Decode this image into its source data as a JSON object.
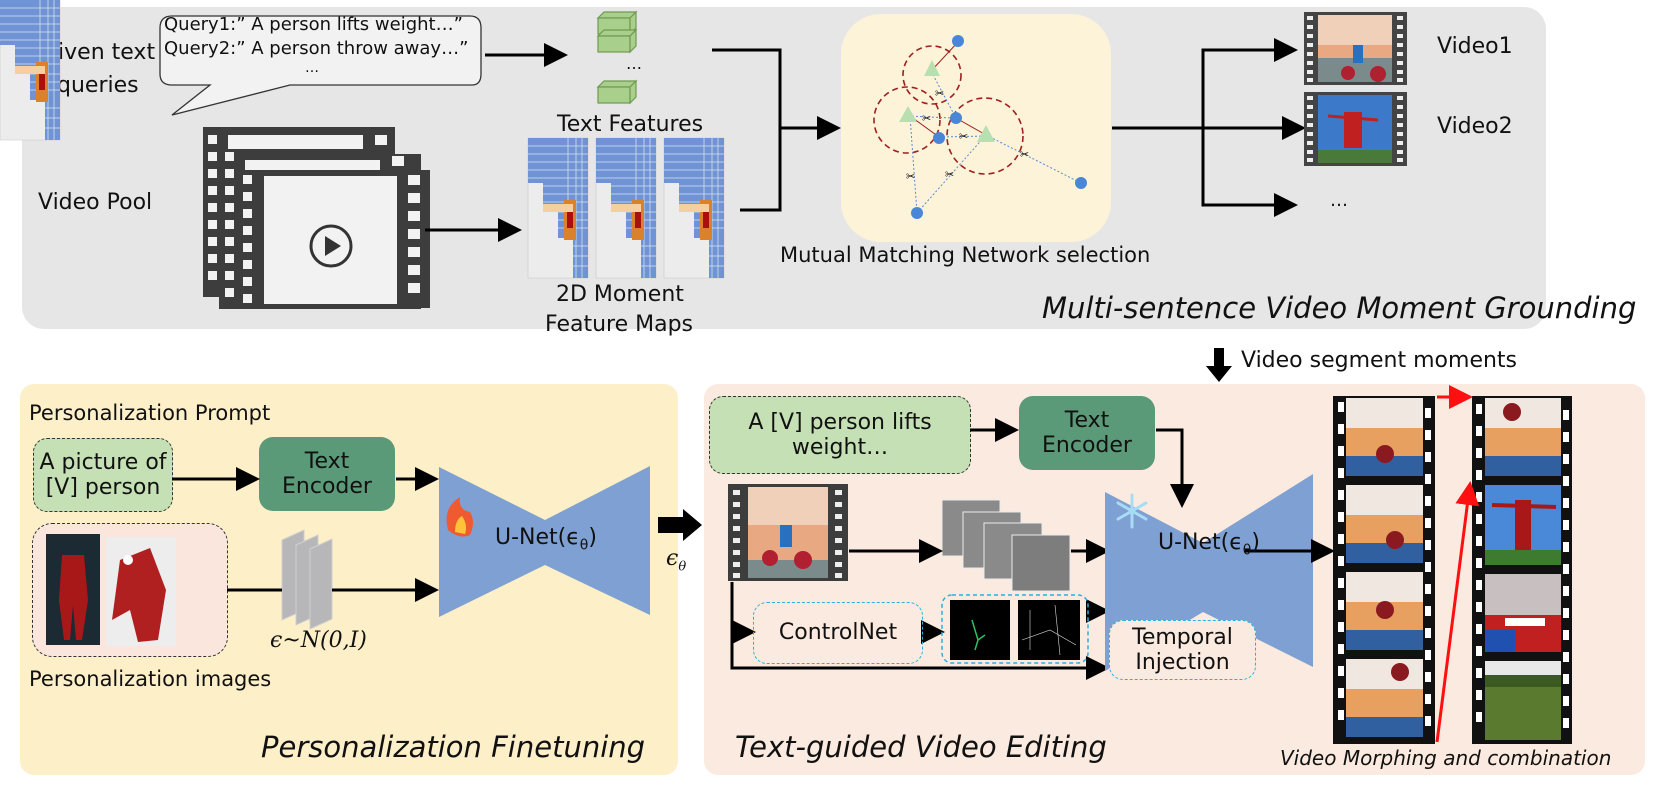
{
  "top_panel": {
    "title": "Multi-sentence Video Moment Grounding",
    "given_text_label_1": "Given text",
    "given_text_label_2": "queries",
    "queries": [
      "Query1:”  A person lifts weight…”",
      "Query2:”  A person throw away…”",
      "…"
    ],
    "video_pool_label": "Video Pool",
    "text_features_label": "Text Features",
    "text_features_ellipsis": "…",
    "feature_maps_label_1": "2D Moment",
    "feature_maps_label_2": "Feature Maps",
    "matching_label": "Mutual Matching Network selection",
    "outputs": [
      "Video1",
      "Video2",
      "…"
    ]
  },
  "transition_label": "Video segment moments",
  "personalization_panel": {
    "title": "Personalization Finetuning",
    "prompt_heading": "Personalization Prompt",
    "prompt_box_1": "A picture of",
    "prompt_box_2": "[V] person",
    "text_encoder_1": "Text",
    "text_encoder_2": "Encoder",
    "unet_label": "U-Net(ϵ",
    "unet_sub": "θ",
    "noise_label": "ϵ~N(0,I)",
    "images_label": "Personalization images"
  },
  "eps_label": "ϵ",
  "eps_sub": "θ",
  "editing_panel": {
    "title": "Text-guided Video Editing",
    "prompt_box_1": "A [V] person lifts",
    "prompt_box_2": "weight…",
    "text_encoder_1": "Text",
    "text_encoder_2": "Encoder",
    "unet_label": "U-Net(ϵ",
    "unet_sub": "θ",
    "controlnet_label": "ControlNet",
    "temporal_1": "Temporal",
    "temporal_2": "Injection",
    "morphing_label": "Video Morphing and combination"
  },
  "colors": {
    "top_bg": "#e6e6e6",
    "personalization_bg": "#fdefc8",
    "editing_bg": "#fbeadf",
    "matching_bg": "#fdf3d8",
    "prompt_green": "#c5e0b4",
    "encoder_green": "#5b9a78",
    "unet_blue": "#7fa0d2",
    "dashed_cyan": "#2bb0e0",
    "red_arrow": "#ff1010",
    "circle_red": "#a02020",
    "node_blue": "#4a86d8",
    "triangle_green": "#b8dfb0"
  }
}
